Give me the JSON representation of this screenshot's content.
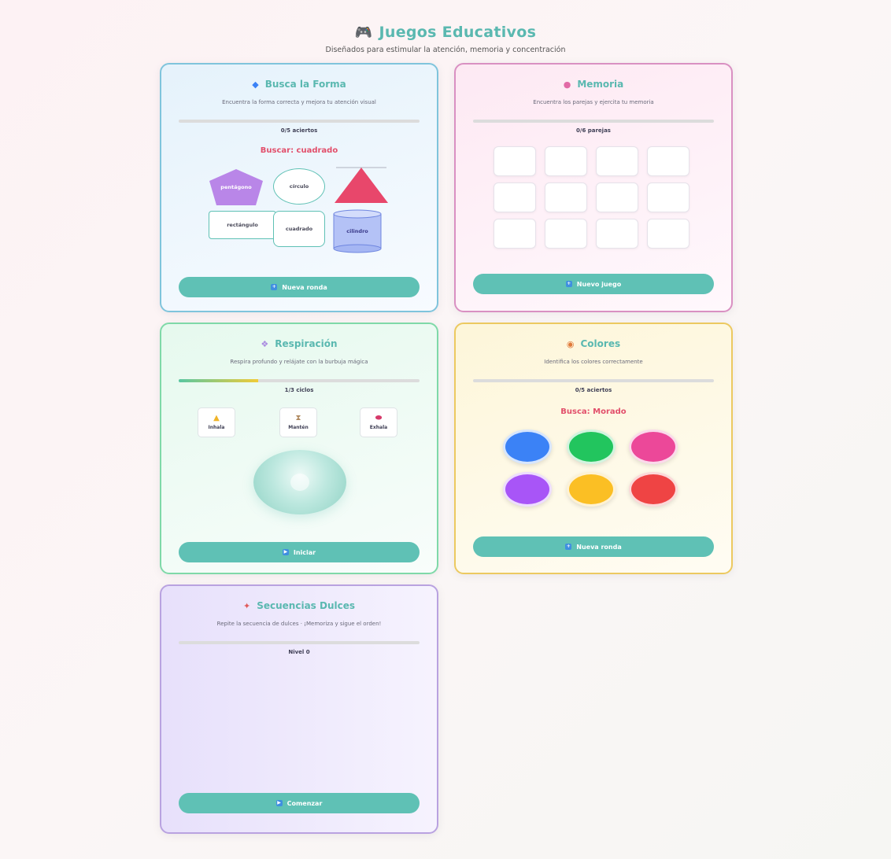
{
  "header": {
    "icon": "gamepad-icon",
    "title": "Juegos Educativos",
    "subtitle": "Diseñados para estimular la atención, memoria y concentración"
  },
  "formas": {
    "icon": "diamond-icon",
    "title": "Busca la Forma",
    "description": "Encuentra la forma correcta y mejora tu atención visual",
    "progress": 0,
    "stat": "0/5 aciertos",
    "target": "Buscar: cuadrado",
    "shapes": {
      "pentagon": "pentágono",
      "circle": "círculo",
      "rectangle": "rectángulo",
      "square": "cuadrado",
      "cylinder": "cilindro"
    },
    "button_icon": "plus-icon",
    "button": "Nueva ronda"
  },
  "memoria": {
    "icon": "brain-icon",
    "title": "Memoria",
    "description": "Encuentra los parejas y ejercita tu memoria",
    "progress": 0,
    "stat": "0/6 parejas",
    "cards": 12,
    "button_icon": "plus-icon",
    "button": "Nuevo juego"
  },
  "respiracion": {
    "icon": "wind-icon",
    "title": "Respiración",
    "description": "Respira profundo y relájate con la burbuja mágica",
    "progress": 0.33,
    "stat": "1/3 ciclos",
    "steps": [
      {
        "icon": "warning-triangle-icon",
        "label": "Inhala"
      },
      {
        "icon": "hourglass-icon",
        "label": "Mantén"
      },
      {
        "icon": "lips-icon",
        "label": "Exhala"
      }
    ],
    "button_icon": "play-icon",
    "button": "Iniciar"
  },
  "colores": {
    "icon": "palette-icon",
    "title": "Colores",
    "description": "Identifica los colores correctamente",
    "progress": 0,
    "stat": "0/5 aciertos",
    "target": "Busca: Morado",
    "colors": [
      "#3b82f6",
      "#22c55e",
      "#ec4899",
      "#a855f7",
      "#fbbf24",
      "#ef4444"
    ],
    "button_icon": "plus-icon",
    "button": "Nueva ronda"
  },
  "secuencias": {
    "icon": "candy-icon",
    "title": "Secuencias Dulces",
    "description": "Repite la secuencia de dulces · ¡Memoriza y sigue el orden!",
    "progress": 0,
    "stat": "Nivel 0",
    "button_icon": "play-icon",
    "button": "Comenzar"
  }
}
